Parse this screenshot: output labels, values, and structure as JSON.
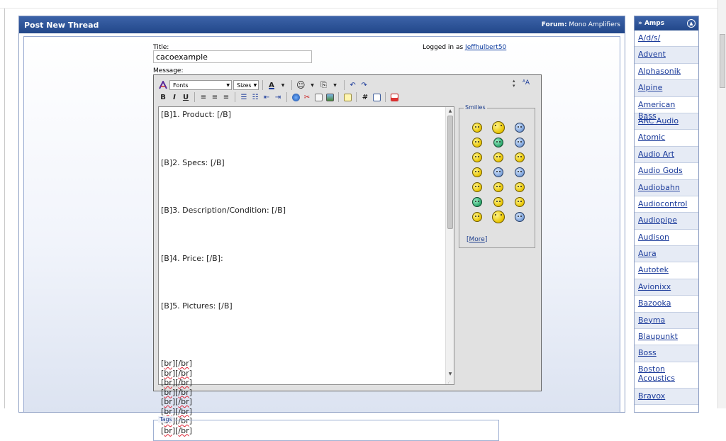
{
  "header": {
    "title": "Post New Thread",
    "forum_label": "Forum:",
    "forum_name": "Mono Amplifiers"
  },
  "form": {
    "title_label": "Title:",
    "title_value": "cacoexample",
    "message_label": "Message:",
    "logged_in_text": "Logged in as",
    "username": "Jeffhulbert50",
    "tags_legend": "Tags"
  },
  "editor": {
    "font_select": "Fonts",
    "size_select": "Sizes",
    "font_color_label": "A",
    "lines": [
      "[B]1. Product: [/B]",
      "[B]2. Specs: [/B]",
      "[B]3. Description/Condition: [/B]",
      "[B]4. Price: [/B]:",
      "[B]5. Pictures: [/B]"
    ],
    "br_tag_open": "br",
    "br_tag_close": "/br",
    "br_count": 8
  },
  "smilies": {
    "legend": "Smilies",
    "more_label": "More"
  },
  "sidebar": {
    "title": "» Amps",
    "items": [
      "A/d/s/",
      "Advent",
      "Alphasonik",
      "Alpine",
      "American Bass",
      "ARC Audio",
      "Atomic",
      "Audio Art",
      "Audio Gods",
      "Audiobahn",
      "Audiocontrol",
      "Audiopipe",
      "Audison",
      "Aura",
      "Autotek",
      "Avionixx",
      "Bazooka",
      "Beyma",
      "Blaupunkt",
      "Boss",
      "Boston Acoustics",
      "Bravox"
    ]
  },
  "colors": {
    "header_blue": "#2b4f93",
    "link_blue": "#1a3a9a"
  }
}
